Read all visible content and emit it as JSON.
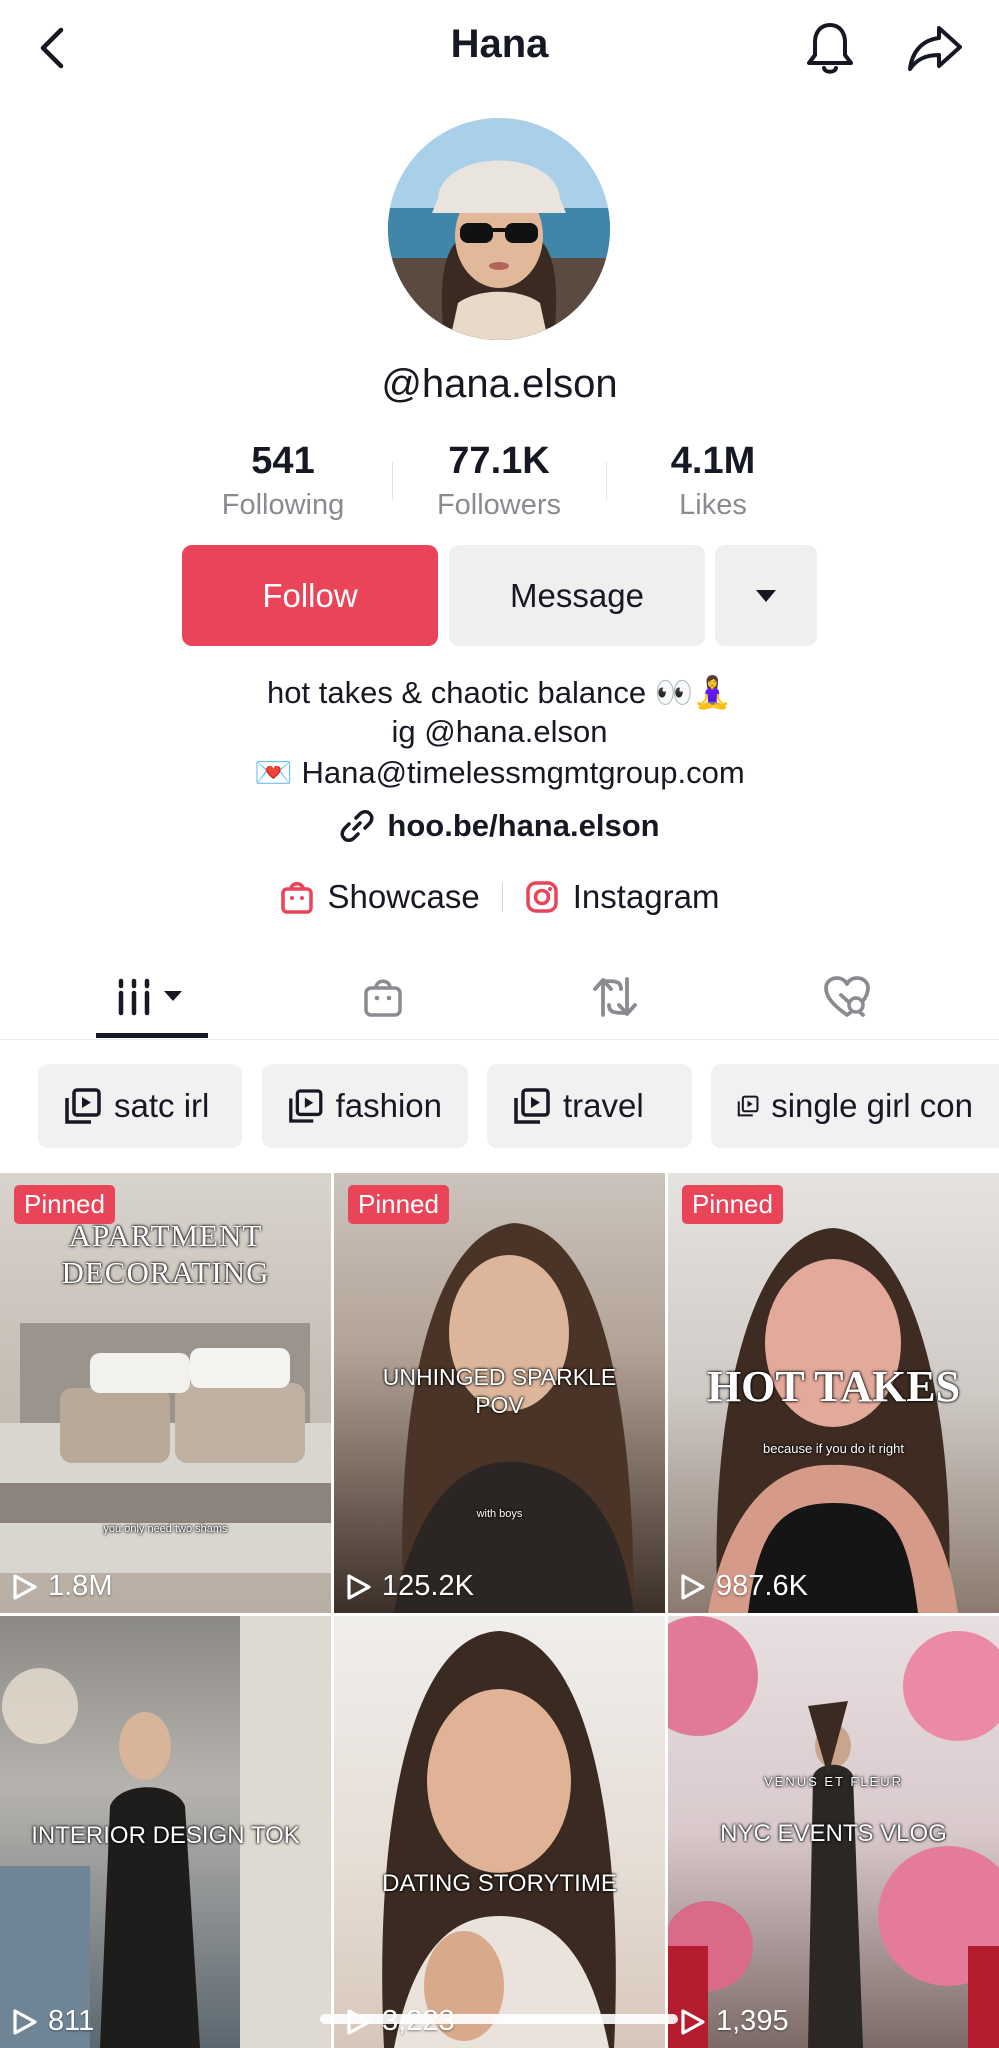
{
  "header": {
    "title": "Hana"
  },
  "profile": {
    "username": "@hana.elson"
  },
  "stats": [
    {
      "value": "541",
      "label": "Following"
    },
    {
      "value": "77.1K",
      "label": "Followers"
    },
    {
      "value": "4.1M",
      "label": "Likes"
    }
  ],
  "actions": {
    "follow": "Follow",
    "message": "Message"
  },
  "bio": {
    "line1": "hot takes & chaotic balance 👀🧘‍♀️",
    "line2": "ig @hana.elson",
    "line3": "💌 Hana@timelessmgmtgroup.com",
    "link": "hoo.be/hana.elson"
  },
  "social": {
    "showcase": "Showcase",
    "instagram": "Instagram"
  },
  "playlists": [
    "satc irl",
    "fashion",
    "travel",
    "single girl con"
  ],
  "videos": [
    {
      "pinned": "Pinned",
      "views": "1.8M",
      "overlay": "APARTMENT DECORATING",
      "caption": "you only need two shams"
    },
    {
      "pinned": "Pinned",
      "views": "125.2K",
      "overlay": "UNHINGED SPARKLE POV",
      "caption": "with boys"
    },
    {
      "pinned": "Pinned",
      "views": "987.6K",
      "overlay": "HOT TAKES",
      "caption": "because if you do it right"
    },
    {
      "views": "811",
      "overlay": "INTERIOR DESIGN TOK"
    },
    {
      "views": "3,223",
      "overlay": "DATING STORYTIME"
    },
    {
      "views": "1,395",
      "overlay": "NYC EVENTS VLOG",
      "sign": "VENUS ET FLEUR"
    }
  ],
  "colors": {
    "accent": "#ea4459",
    "text": "#161823",
    "muted": "#8a8b91",
    "chip_bg": "#f1f1f2"
  }
}
